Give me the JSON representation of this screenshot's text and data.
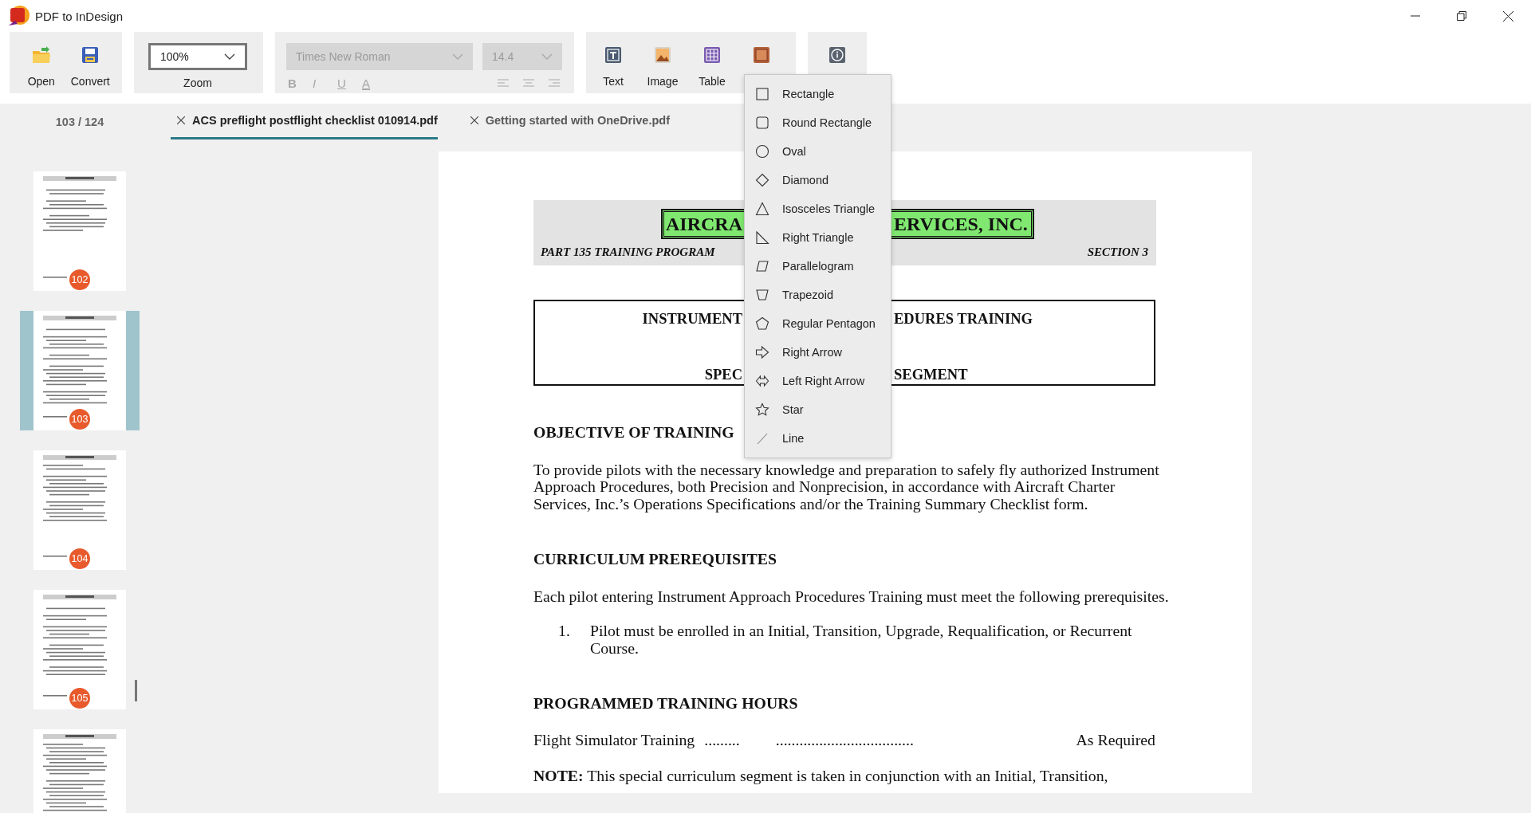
{
  "window": {
    "title": "PDF to InDesign"
  },
  "file_group": {
    "buttons": [
      {
        "label": "Open",
        "kind": "open"
      },
      {
        "label": "Convert",
        "kind": "convert"
      }
    ]
  },
  "zoom_group": {
    "value": "100%",
    "label": "Zoom"
  },
  "font_group": {
    "font": "Times New Roman",
    "size": "14.4",
    "disabled": true,
    "format_buttons": [
      {
        "glyph": "B",
        "kind": "bold"
      },
      {
        "glyph": "I",
        "kind": "italic"
      },
      {
        "glyph": "U",
        "kind": "underline"
      },
      {
        "glyph": "A",
        "kind": "color"
      }
    ],
    "align_buttons": [
      {
        "kind": "left"
      },
      {
        "kind": "center"
      },
      {
        "kind": "right"
      }
    ]
  },
  "insert_group": {
    "buttons": [
      {
        "label": "Text",
        "kind": "text"
      },
      {
        "label": "Image",
        "kind": "image"
      },
      {
        "label": "Table",
        "kind": "table"
      },
      {
        "kind": "shape"
      }
    ]
  },
  "page_counter": "103 / 124",
  "tabs": [
    {
      "label": "ACS preflight postflight checklist 010914.pdf",
      "selected": true
    },
    {
      "label": "Getting started with OneDrive.pdf",
      "selected": false
    }
  ],
  "thumbnails": [
    {
      "page": "102",
      "selected": false
    },
    {
      "page": "103",
      "selected": true
    },
    {
      "page": "104",
      "selected": false
    },
    {
      "page": "105",
      "selected": false
    },
    {
      "selected": false
    }
  ],
  "document": {
    "company_left": "AIRCRA",
    "company_right": "ERVICES, INC.",
    "program": "PART 135 TRAINING PROGRAM",
    "section": "SECTION 3",
    "title_lines": [
      {
        "left": "INSTRUMENT",
        "right": "EDURES TRAINING"
      },
      {
        "left": "SPEC",
        "right": "SEGMENT"
      }
    ],
    "blocks": [
      {
        "kind": "heading",
        "text": "OBJECTIVE OF TRAINING"
      },
      {
        "kind": "paragraph",
        "text": "To provide pilots with the necessary knowledge and preparation to safely fly authorized Instrument Approach Procedures, both Precision and Nonprecision, in accordance with Aircraft Charter Services, Inc.’s Operations Specifications and/or the Training Summary Checklist form."
      },
      {
        "kind": "heading",
        "text": "CURRICULUM PREREQUISITES"
      },
      {
        "kind": "paragraph",
        "text": "Each pilot entering Instrument Approach Procedures Training must meet the following prerequisites."
      },
      {
        "kind": "list_item",
        "number": "1.",
        "text": "Pilot must be enrolled in an Initial, Transition, Upgrade, Requalification, or Recurrent Course."
      },
      {
        "kind": "heading",
        "text": "PROGRAMMED TRAINING HOURS"
      },
      {
        "kind": "leader_row",
        "label": "Flight Simulator Training",
        "dots_1": ".........",
        "dots_2": "...................................",
        "value": "As Required"
      },
      {
        "kind": "note",
        "text": "**NOTE:**  This special curriculum segment is taken in conjunction with an Initial, Transition,"
      }
    ]
  },
  "shape_menu": {
    "items": [
      {
        "label": "Rectangle",
        "kind": "rectangle"
      },
      {
        "label": "Round Rectangle",
        "kind": "round_rectangle"
      },
      {
        "label": "Oval",
        "kind": "oval"
      },
      {
        "label": "Diamond",
        "kind": "diamond"
      },
      {
        "label": "Isosceles Triangle",
        "kind": "isosceles_triangle"
      },
      {
        "label": "Right Triangle",
        "kind": "right_triangle"
      },
      {
        "label": "Parallelogram",
        "kind": "parallelogram"
      },
      {
        "label": "Trapezoid",
        "kind": "trapezoid"
      },
      {
        "label": "Regular Pentagon",
        "kind": "pentagon"
      },
      {
        "label": "Right Arrow",
        "kind": "right_arrow"
      },
      {
        "label": "Left Right Arrow",
        "kind": "left_right_arrow"
      },
      {
        "label": "Star",
        "kind": "star"
      },
      {
        "label": "Line",
        "kind": "line"
      }
    ]
  }
}
